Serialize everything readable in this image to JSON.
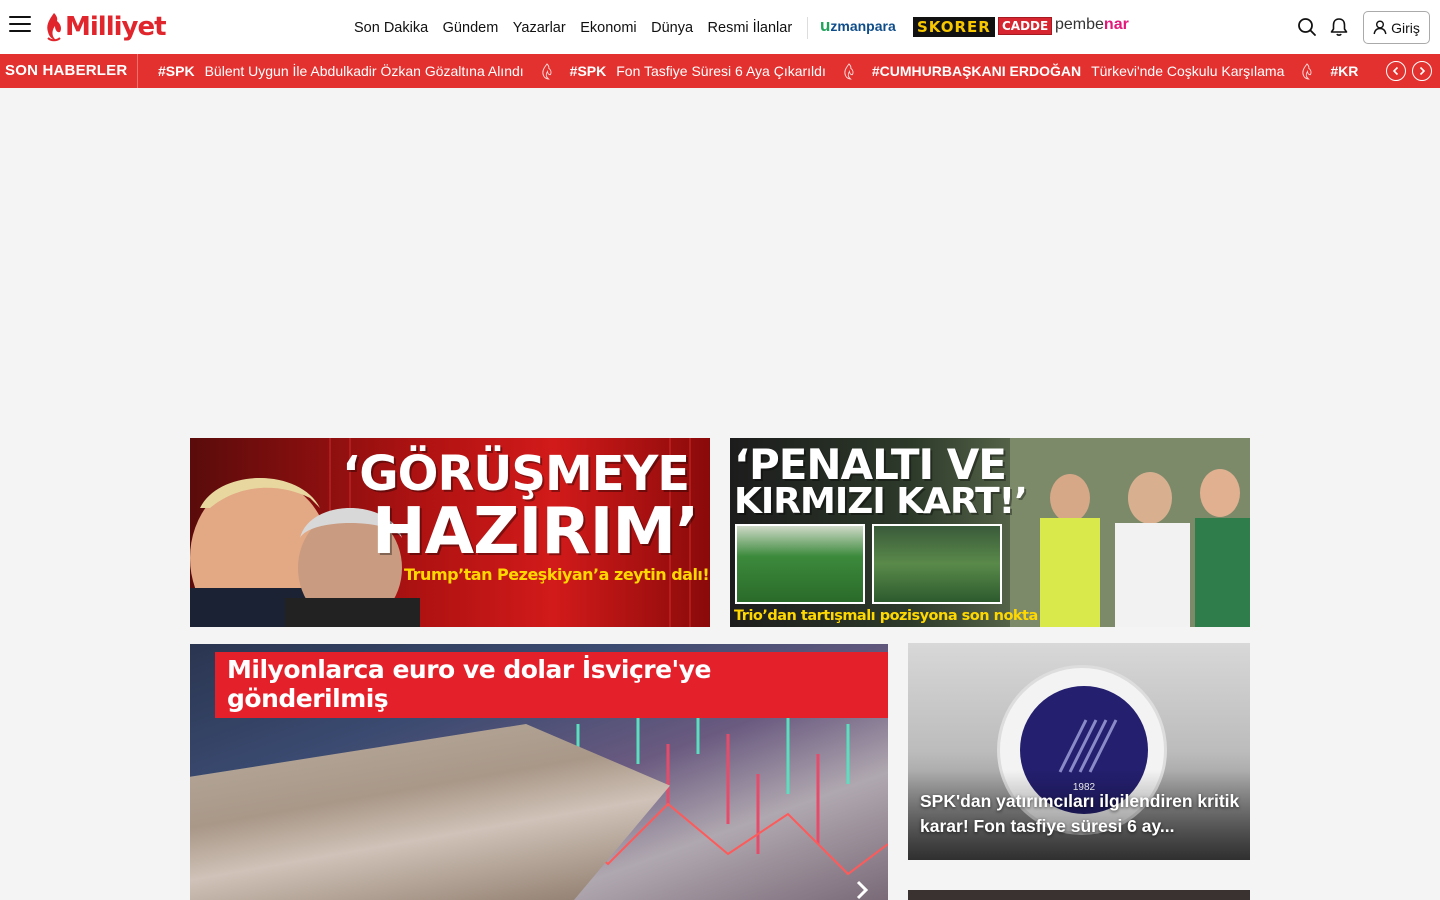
{
  "header": {
    "logo_text": "Milliyet",
    "nav": [
      "Son Dakika",
      "Gündem",
      "Yazarlar",
      "Ekonomi",
      "Dünya",
      "Resmi İlanlar"
    ],
    "partners": {
      "uzmanpara_a": "u",
      "uzmanpara_b": "zmanpara",
      "skorer": "SKORER",
      "cadde": "CADDE",
      "pembenar_a": "pembe",
      "pembenar_b": "nar"
    },
    "login_label": "Giriş",
    "icons": [
      "menu-icon",
      "search-icon",
      "bell-icon",
      "user-icon"
    ]
  },
  "ticker": {
    "label": "SON HABERLER",
    "items": [
      {
        "tag": "#SPK",
        "text": "Bülent Uygun İle Abdulkadir Özkan Gözaltına Alındı"
      },
      {
        "tag": "#SPK",
        "text": "Fon Tasfiye Süresi 6 Aya Çıkarıldı"
      },
      {
        "tag": "#CUMHURBAŞKANI ERDOĞAN",
        "text": "Türkevi'nde Coşkulu Karşılama"
      },
      {
        "tag": "#KR",
        "text": ""
      }
    ]
  },
  "banners": [
    {
      "headline_1": "‘GÖRÜŞMEYE",
      "headline_2": "HAZIRIM’",
      "sub": "Trump’tan Pezeşkiyan’a zeytin dalı!"
    },
    {
      "headline_1": "‘PENALTI VE",
      "headline_2": "KIRMIZI KART!’",
      "sub": "Trio’dan tartışmalı pozisyona son nokta"
    }
  ],
  "main_story": {
    "title": "Milyonlarca euro ve dolar İsviçre'ye gönderilmiş"
  },
  "side_story": {
    "caption": "SPK'dan yatırımcıları ilgilendiren kritik karar! Fon tasfiye süresi 6 ay...",
    "seal_year": "1982"
  },
  "colors": {
    "brand_red": "#e3312f",
    "logo_red": "#e0262c",
    "highlight_yellow": "#ffd800"
  }
}
